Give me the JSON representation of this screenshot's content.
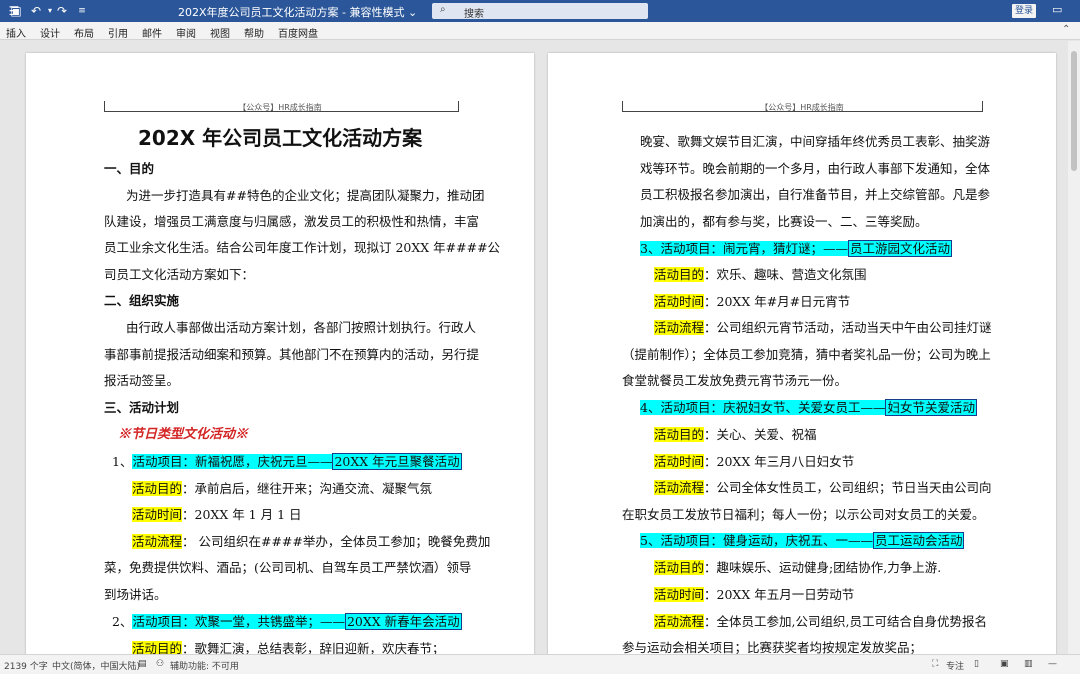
{
  "titlebar": {
    "doc_title": "202X年度公司员工文化活动方案  -  兼容性模式 ⌄",
    "search_placeholder": "搜索",
    "login_label": "登录",
    "icons": [
      "save-icon",
      "undo-icon",
      "redo-icon",
      "customize-icon",
      "search-icon",
      "ribbon-display-icon"
    ]
  },
  "menu": {
    "items": [
      "插入",
      "设计",
      "布局",
      "引用",
      "邮件",
      "审阅",
      "视图",
      "帮助",
      "百度网盘"
    ]
  },
  "header_text": "【公众号】HR成长指南",
  "left_page": {
    "doc_title": "202X 年公司员工文化活动方案",
    "sec1": "一、目的",
    "p1": [
      "为进一步打造具有##特色的企业文化；提高团队凝聚力，推动团",
      "队建设，增强员工满意度与归属感，激发员工的积极性和热情，丰富",
      "员工业余文化生活。结合公司年度工作计划，现拟订 20XX 年####公",
      "司员工文化活动方案如下："
    ],
    "sec2": "二、组织实施",
    "p2": [
      "由行政人事部做出活动方案计划，各部门按照计划执行。行政人",
      "事部事前提报活动细案和预算。其他部门不在预算内的活动，另行提",
      "报活动签呈。"
    ],
    "sec3": "三、活动计划",
    "red_title": "※节日类型文化活动※",
    "item1_num": "1、",
    "item1_label": "活动项目：新福祝愿，庆祝元旦——",
    "item1_boxed": "20XX 年元旦聚餐活动",
    "purpose_label": "活动目的",
    "time_label": "活动时间",
    "process_label": "活动流程",
    "item1_purpose": "：承前启后，继往开来；沟通交流、凝聚气氛",
    "item1_time": "：20XX 年 1 月 1 日",
    "item1_process": "：  公司组织在####举办，全体员工参加；晚餐免费加",
    "item1_process_2": "菜，免费提供饮料、酒品；(公司司机、自驾车员工严禁饮酒）领导",
    "item1_process_3": "到场讲话。",
    "item2_num": "2、",
    "item2_label": "活动项目：欢聚一堂，共镌盛举；——",
    "item2_boxed": "20XX 新春年会活动",
    "item2_purpose": "：歌舞汇演，总结表彰，辞旧迎新，欢庆春节；"
  },
  "right_page": {
    "cont": [
      "晚宴、歌舞文娱节目汇演，中间穿插年终优秀员工表彰、抽奖游",
      "戏等环节。晚会前期的一个多月，由行政人事部下发通知，全体",
      "员工积极报名参加演出，自行准备节目，并上交综管部。凡是参",
      "加演出的，都有参与奖，比赛设一、二、三等奖励。"
    ],
    "item3_label": "3、活动项目：闹元宵，猜灯谜；——",
    "item3_boxed": "员工游园文化活动",
    "item3_purpose": "：欢乐、趣味、营造文化氛围",
    "item3_time": "：20XX 年#月#日元宵节",
    "item3_process": "：公司组织元宵节活动，活动当天中午由公司挂灯谜",
    "item3_process_2": "（提前制作）；全体员工参加竞猜，猜中者奖礼品一份；公司为晚上",
    "item3_process_3": "食堂就餐员工发放免费元宵节汤元一份。",
    "item4_label": "4、活动项目：庆祝妇女节、关爱女员工——",
    "item4_boxed": "妇女节关爱活动",
    "item4_purpose": "：关心、关爱、祝福",
    "item4_time": "：20XX 年三月八日妇女节",
    "item4_process": "：公司全体女性员工，公司组织；节日当天由公司向",
    "item4_process_2": "在职女员工发放节日福利；每人一份；以示公司对女员工的关爱。",
    "item5_label": "5、活动项目：健身运动，庆祝五、一——",
    "item5_boxed": "员工运动会活动",
    "item5_purpose": "：趣味娱乐、运动健身;团结协作,力争上游.",
    "item5_time": "：20XX 年五月一日劳动节",
    "item5_process": "：全体员工参加,公司组织,员工可结合自身优势报名",
    "item5_process_2": "参与运动会相关项目；比赛获奖者均按规定发放奖品；"
  },
  "status": {
    "word_count": "2139 个字",
    "language": "中文(简体，中国大陆)",
    "accessibility": "辅助功能: 不可用",
    "focus": "专注"
  }
}
